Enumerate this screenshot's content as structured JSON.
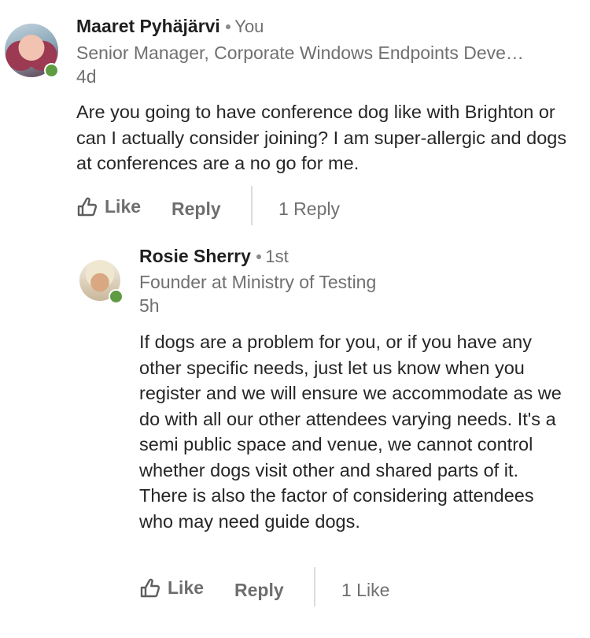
{
  "comment": {
    "author": "Maaret Pyhäjärvi",
    "relation": "You",
    "headline": "Senior Manager, Corporate Windows Endpoints Deve…",
    "time": "4d",
    "text": "Are you going to have conference dog like with Brighton or can I actually consider joining? I am super-allergic and dogs at conferences are a no go for me.",
    "like_label": "Like",
    "reply_label": "Reply",
    "replies_count": "1 Reply"
  },
  "reply": {
    "author": "Rosie Sherry",
    "relation": "1st",
    "headline": "Founder at Ministry of Testing",
    "time": "5h",
    "text": "If dogs are a problem for you, or if you have any other specific needs, just let us know when you register and we will ensure we accommodate as we do with all our other attendees varying needs. It's a semi public space and venue, we cannot control whether dogs visit other and shared parts of it.  There is also the factor of considering attendees who may need guide dogs.",
    "like_label": "Like",
    "reply_label": "Reply",
    "likes_count": "1 Like"
  },
  "colors": {
    "presence": "#5f9b41",
    "action_text": "#6e6e6e",
    "divider": "#dcdcdc"
  }
}
